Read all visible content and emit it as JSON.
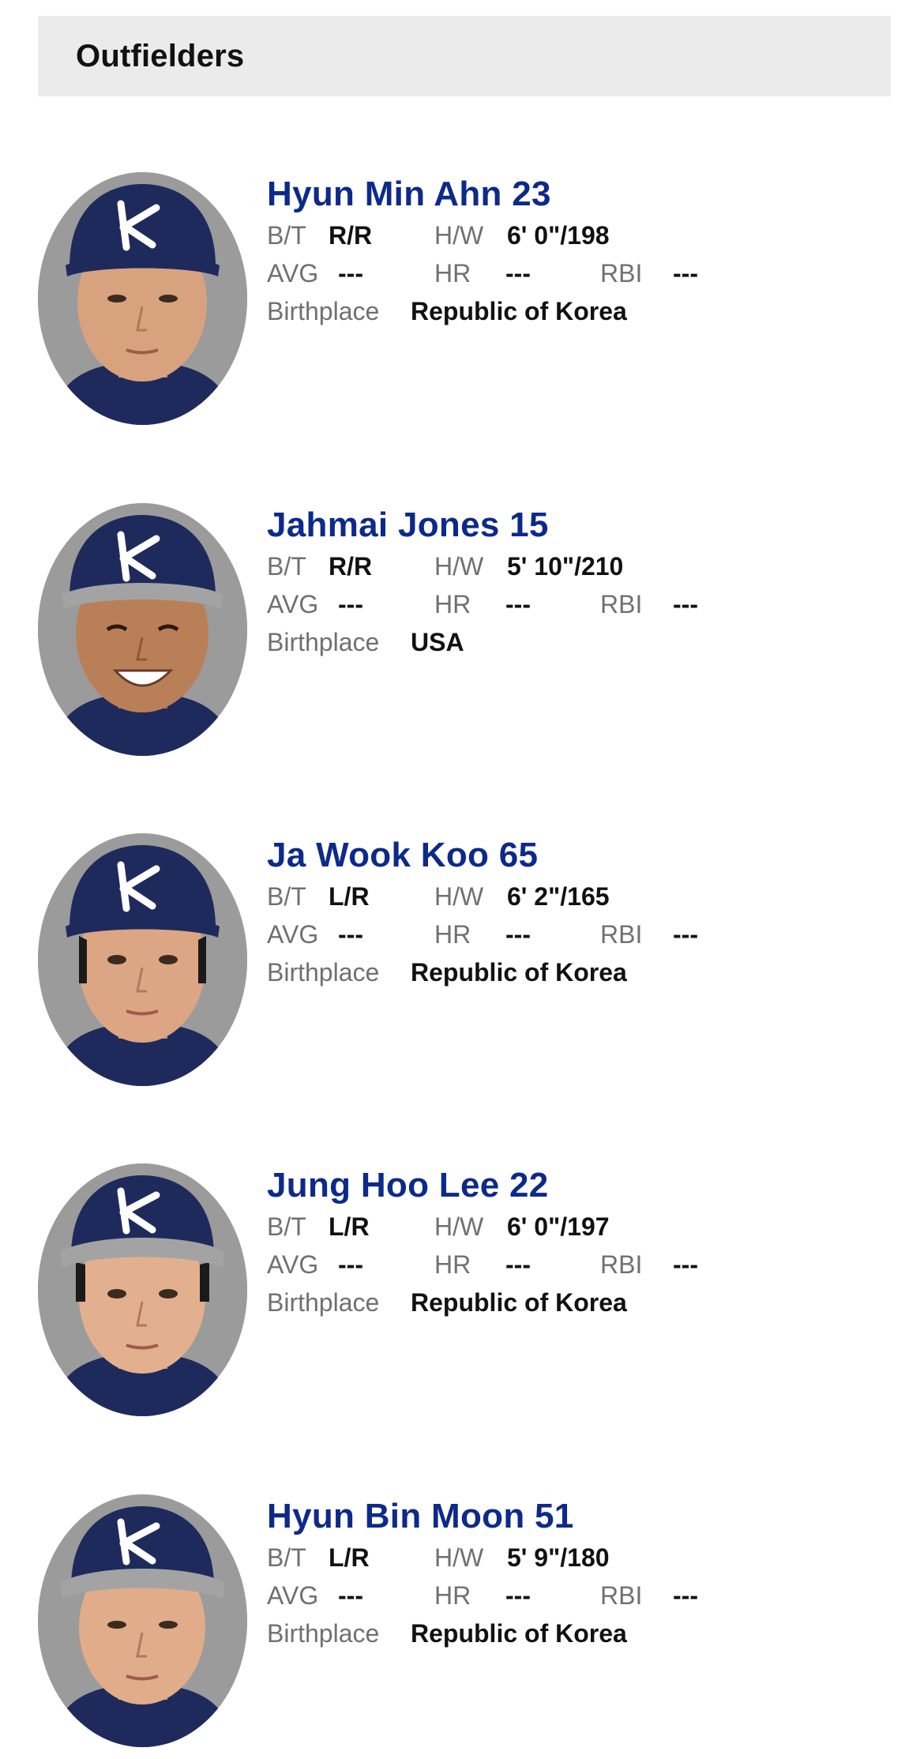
{
  "section": {
    "title": "Outfielders"
  },
  "labels": {
    "bt": "B/T",
    "hw": "H/W",
    "avg": "AVG",
    "hr": "HR",
    "rbi": "RBI",
    "birthplace": "Birthplace"
  },
  "players": [
    {
      "name": "Hyun Min Ahn 23",
      "bt": "R/R",
      "hw": "6' 0\"/198",
      "avg": "---",
      "hr": "---",
      "rbi": "---",
      "birthplace": "Republic of Korea",
      "cap_brim": "navy"
    },
    {
      "name": "Jahmai Jones 15",
      "bt": "R/R",
      "hw": "5' 10\"/210",
      "avg": "---",
      "hr": "---",
      "rbi": "---",
      "birthplace": "USA",
      "cap_brim": "gray"
    },
    {
      "name": "Ja Wook Koo 65",
      "bt": "L/R",
      "hw": "6' 2\"/165",
      "avg": "---",
      "hr": "---",
      "rbi": "---",
      "birthplace": "Republic of Korea",
      "cap_brim": "navy"
    },
    {
      "name": "Jung Hoo Lee 22",
      "bt": "L/R",
      "hw": "6' 0\"/197",
      "avg": "---",
      "hr": "---",
      "rbi": "---",
      "birthplace": "Republic of Korea",
      "cap_brim": "gray"
    },
    {
      "name": "Hyun Bin Moon 51",
      "bt": "L/R",
      "hw": "5' 9\"/180",
      "avg": "---",
      "hr": "---",
      "rbi": "---",
      "birthplace": "Republic of Korea",
      "cap_brim": "gray"
    }
  ],
  "colors": {
    "name": "#0d2a8a",
    "label": "#707070",
    "value": "#111111",
    "header_bg": "#ebebeb",
    "cap_navy": "#1f2a5c",
    "skin": "#d9a27f"
  }
}
